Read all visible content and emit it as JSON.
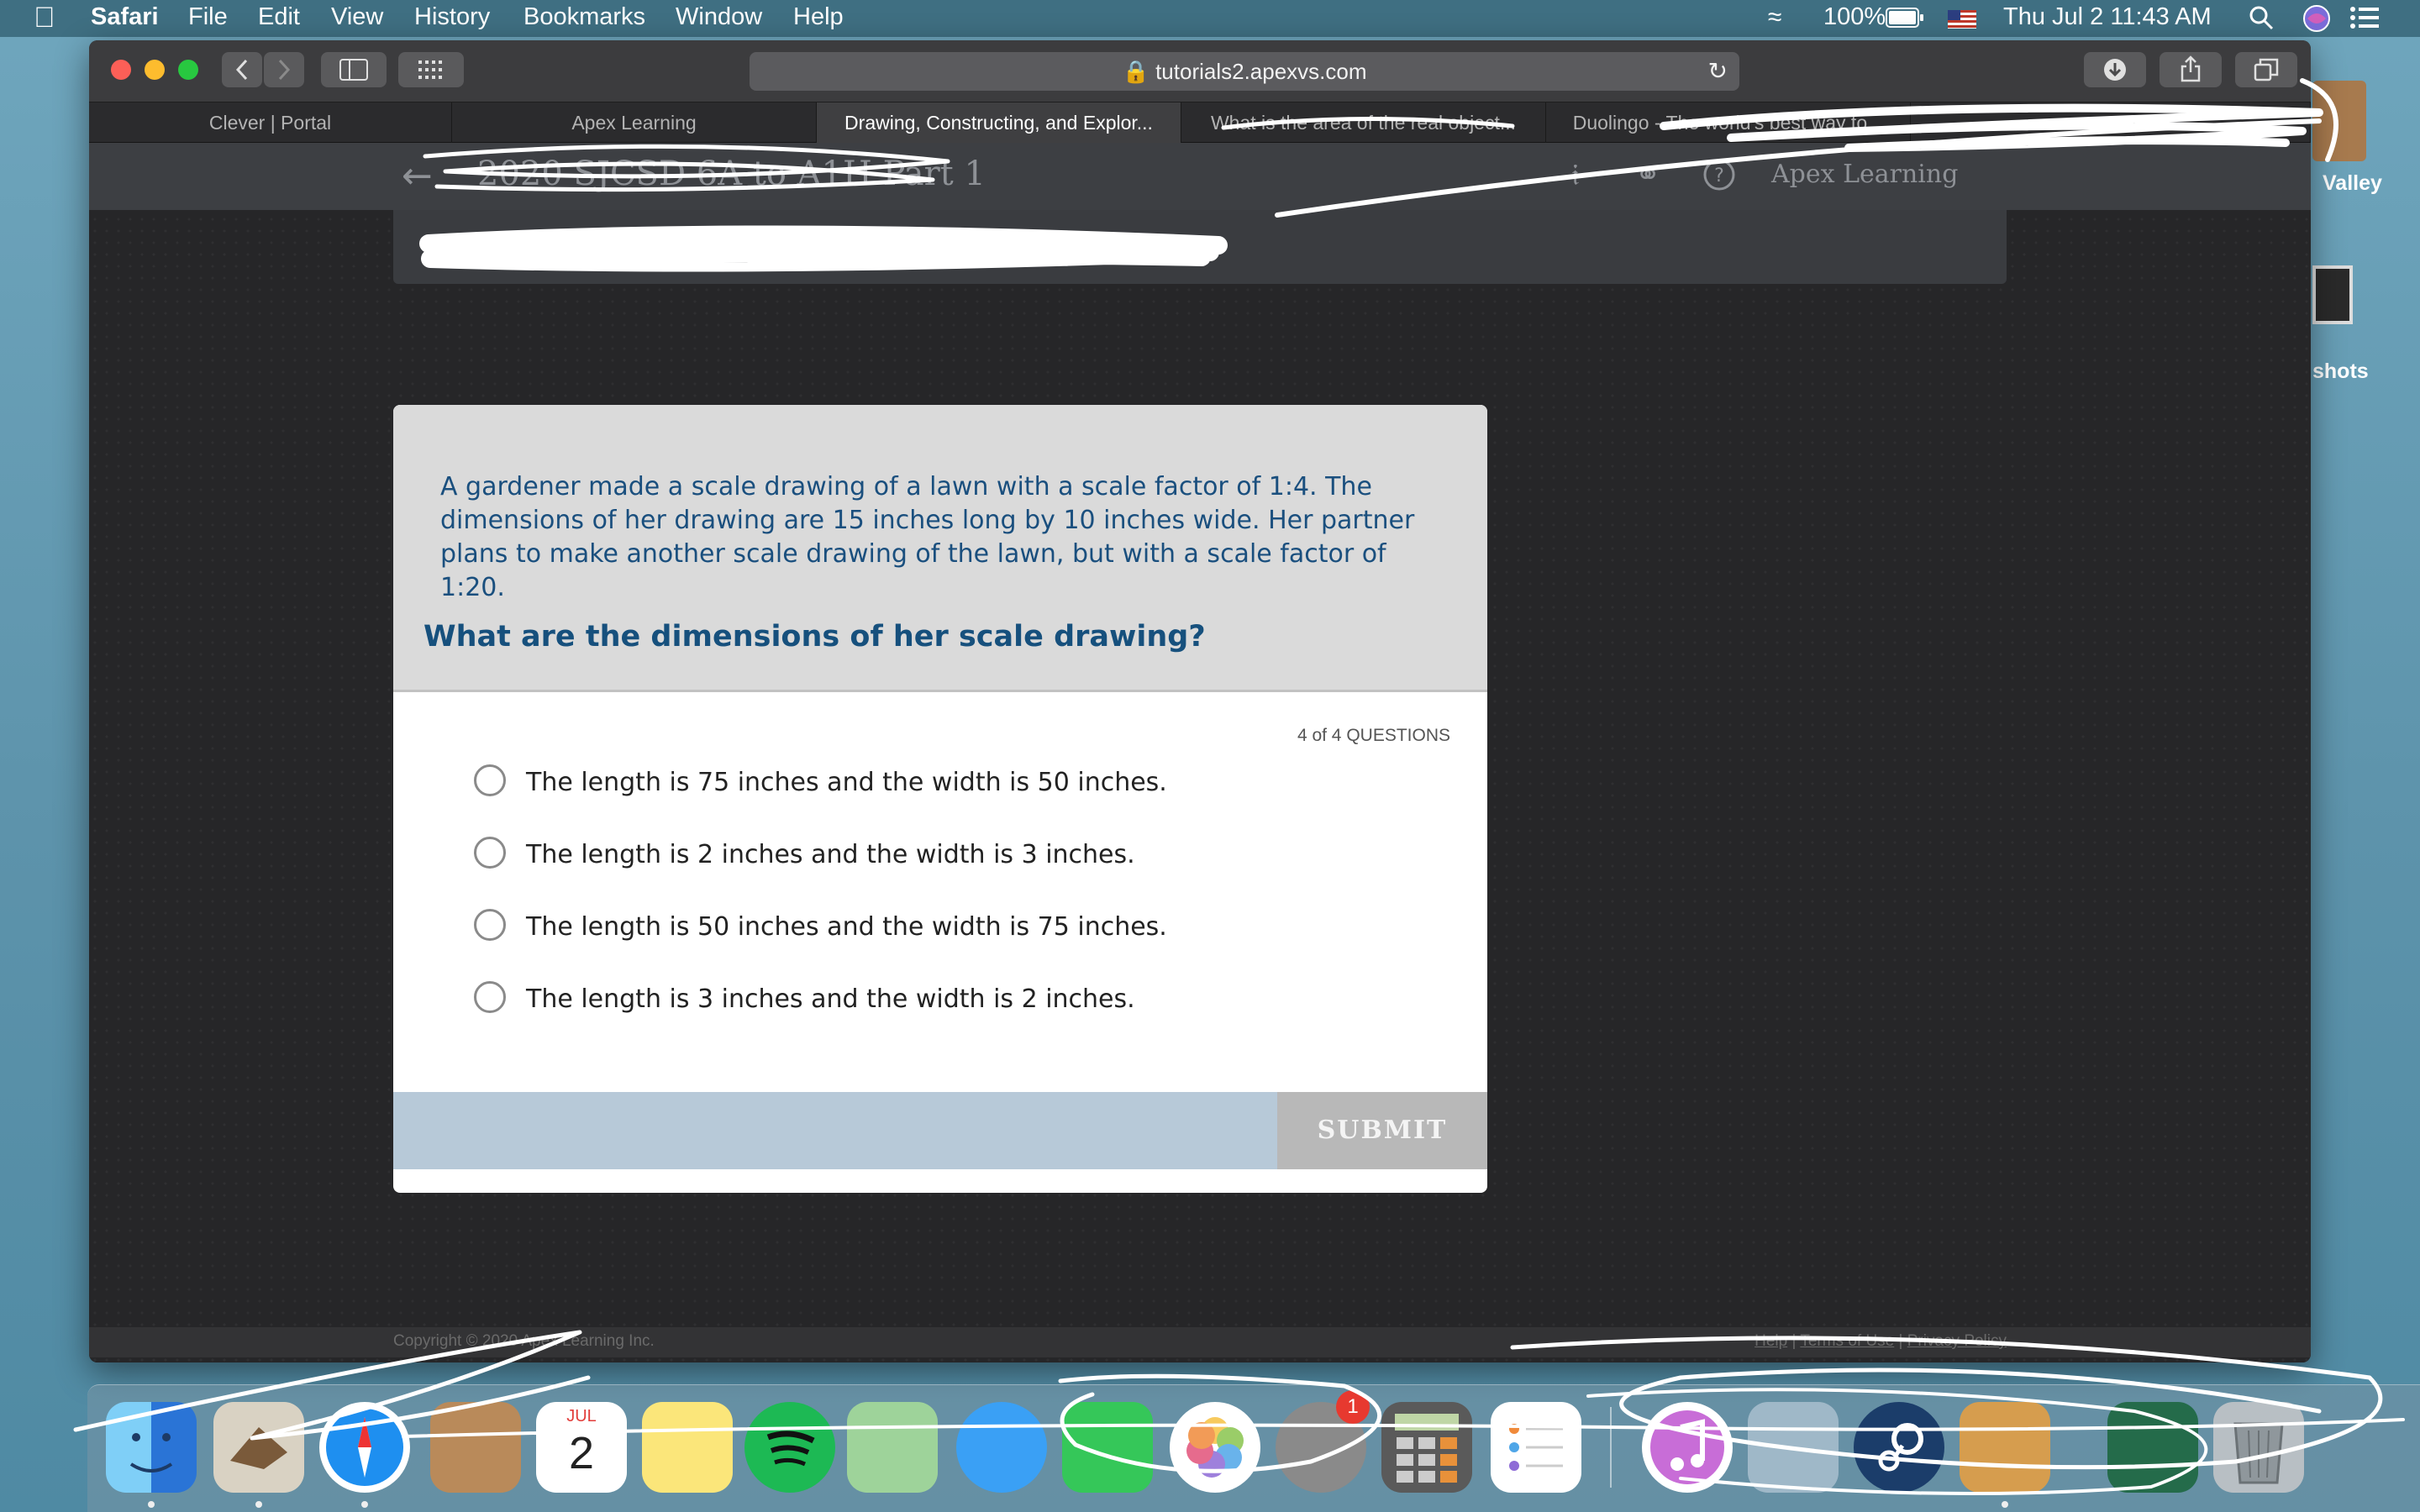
{
  "menubar": {
    "app_name": "Safari",
    "menus": [
      "File",
      "Edit",
      "View",
      "History",
      "Bookmarks",
      "Window",
      "Help"
    ],
    "battery": "100%",
    "datetime": "Thu Jul 2  11:43 AM"
  },
  "browser": {
    "url": "tutorials2.apexvs.com",
    "tabs": [
      {
        "label": "Clever | Portal",
        "active": false
      },
      {
        "label": "Apex Learning",
        "active": false
      },
      {
        "label": "Drawing, Constructing, and Explor...",
        "active": true
      },
      {
        "label": "What is the area of the real object...",
        "active": false
      },
      {
        "label": "Duolingo - The world's best way to...",
        "active": false
      }
    ]
  },
  "app_header": {
    "course_title": "2020 SJCSD 6A to A1H Part 1",
    "brand": "Apex Learning"
  },
  "question": {
    "stem": "A gardener made a scale drawing of a lawn with a scale factor of 1:4. The dimensions of her drawing are 15 inches long by 10 inches wide. Her partner plans to make another scale drawing of the lawn, but with a scale factor of 1:20.",
    "prompt": "What are the dimensions of her scale drawing?",
    "count": "4 of 4 QUESTIONS",
    "options": [
      "The length is 75 inches and the width is 50 inches.",
      "The length is 2 inches and the width is 3 inches.",
      "The length is 50 inches and the width is 75 inches.",
      "The length is 3 inches and the width is 2 inches."
    ],
    "submit_label": "SUBMIT"
  },
  "footer": {
    "copyright": "Copyright © 2020 Apex Learning Inc.",
    "links": [
      "Help",
      "Terms of Use",
      "Privacy Policy"
    ]
  },
  "desktop": {
    "labels": [
      "Valley",
      "shots"
    ]
  },
  "dock": {
    "apps": [
      "finder",
      "mail",
      "safari",
      "contacts",
      "calendar",
      "notes",
      "spotify",
      "maps",
      "messages",
      "facetime",
      "photos",
      "system-preferences",
      "calculator",
      "reminders",
      "itunes",
      "preview",
      "steam",
      "game",
      "launcher",
      "trash"
    ],
    "calendar_month": "JUL",
    "calendar_day": "2",
    "system_preferences_badge": "1"
  }
}
